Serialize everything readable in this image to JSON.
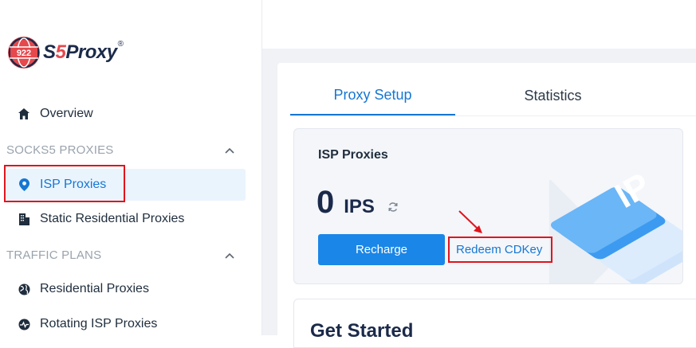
{
  "brand": {
    "logo_badge": "922",
    "name_prefix": "S",
    "name_five": "5",
    "name_suffix": "Proxy",
    "reg": "®"
  },
  "sidebar": {
    "overview": "Overview",
    "section_socks": "SOCKS5 PROXIES",
    "isp_proxies": "ISP Proxies",
    "static_residential": "Static Residential Proxies",
    "section_traffic": "TRAFFIC PLANS",
    "residential": "Residential Proxies",
    "rotating_isp": "Rotating ISP Proxies"
  },
  "tabs": [
    "Proxy Setup",
    "Statistics"
  ],
  "card": {
    "title": "ISP Proxies",
    "count": "0",
    "unit": "IPS",
    "recharge_label": "Recharge",
    "redeem_label": "Redeem CDKey",
    "art_text": "IP"
  },
  "get_started": "Get Started",
  "colors": {
    "accent": "#1677d2",
    "annotation": "#e0141d",
    "brand_red": "#e5484d"
  }
}
